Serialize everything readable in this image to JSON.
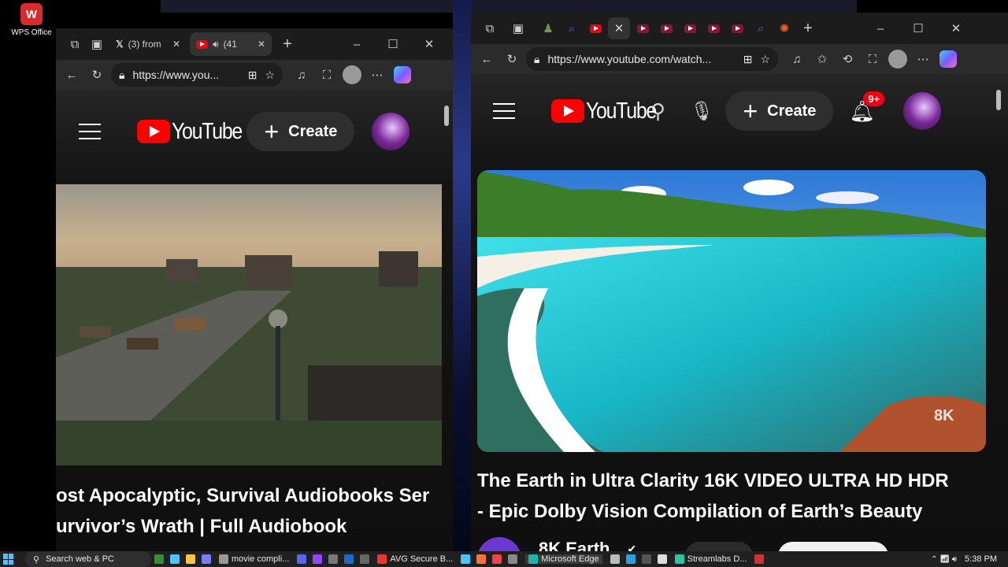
{
  "desktop": {
    "wps_label": "WPS Office"
  },
  "left_window": {
    "tabs": [
      {
        "label": "(3) from",
        "icon": "x-logo-icon"
      },
      {
        "label": "(41",
        "icon": "youtube-icon"
      }
    ],
    "url": "https://www.you...",
    "yt": {
      "logo": "YouTube",
      "create_label": "Create"
    },
    "video_title_line1": "ost Apocalyptic, Survival Audiobooks Ser",
    "video_title_line2": "urvivor’s Wrath | Full Audiobook"
  },
  "right_window": {
    "url": "https://www.youtube.com/watch...",
    "yt": {
      "logo": "YouTube",
      "create_label": "Create",
      "notification_badge": "9+"
    },
    "thumbnail_watermark": "8K",
    "video_title_line1": "The Earth in Ultra Clarity 16K VIDEO ULTRA HD HDR",
    "video_title_line2": "- Epic Dolby Vision Compilation of Earth’s Beauty",
    "channel_name": "8K Earth"
  },
  "taskbar": {
    "search_placeholder": "Search web & PC",
    "apps": [
      {
        "label": "movie compli..."
      },
      {
        "label": "AVG Secure B..."
      },
      {
        "label": "Microsoft Edge"
      },
      {
        "label": "Streamlabs D..."
      }
    ],
    "time": "5:38 PM"
  },
  "colors": {
    "youtube_red": "#ff0000",
    "dark_bg": "#0f0f0f",
    "tab_bar": "#1c1c1c"
  }
}
